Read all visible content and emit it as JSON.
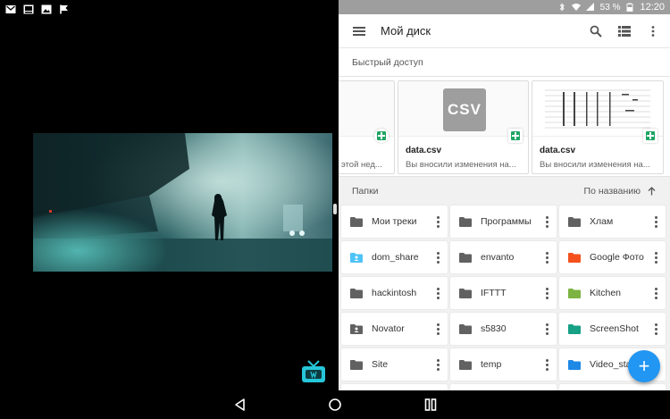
{
  "status_bar": {
    "battery": "53 %",
    "time": "12:20"
  },
  "drive": {
    "title": "Мой диск",
    "quick_access_label": "Быстрый доступ",
    "quick_items": [
      {
        "name": "",
        "desc": "а этой нед..."
      },
      {
        "name": "data.csv",
        "desc": "Вы вносили изменения на...",
        "thumb": "CSV"
      },
      {
        "name": "data.csv",
        "desc": "Вы вносили изменения на..."
      }
    ],
    "folders_label": "Папки",
    "sort_label": "По названию",
    "folders": [
      {
        "name": "Мои треки",
        "color": "#616161"
      },
      {
        "name": "Программы",
        "color": "#616161"
      },
      {
        "name": "Хлам",
        "color": "#616161"
      },
      {
        "name": "dom_share",
        "color": "#4fc3f7"
      },
      {
        "name": "envanto",
        "color": "#616161"
      },
      {
        "name": "Google Фото",
        "color": "#f4511e"
      },
      {
        "name": "hackintosh",
        "color": "#616161"
      },
      {
        "name": "IFTTT",
        "color": "#616161"
      },
      {
        "name": "Kitchen",
        "color": "#7cb342"
      },
      {
        "name": "Novator",
        "color": "#616161"
      },
      {
        "name": "s5830",
        "color": "#616161"
      },
      {
        "name": "ScreenShot",
        "color": "#16a085"
      },
      {
        "name": "Site",
        "color": "#616161"
      },
      {
        "name": "temp",
        "color": "#616161"
      },
      {
        "name": "Video_sta",
        "color": "#1e88e5"
      }
    ],
    "fab_label": "+"
  },
  "colors": {
    "accent": "#2196f3",
    "sheets_green": "#1fa463",
    "status_bar": "#9e9e9e",
    "tv_icon": "#26c6da"
  }
}
